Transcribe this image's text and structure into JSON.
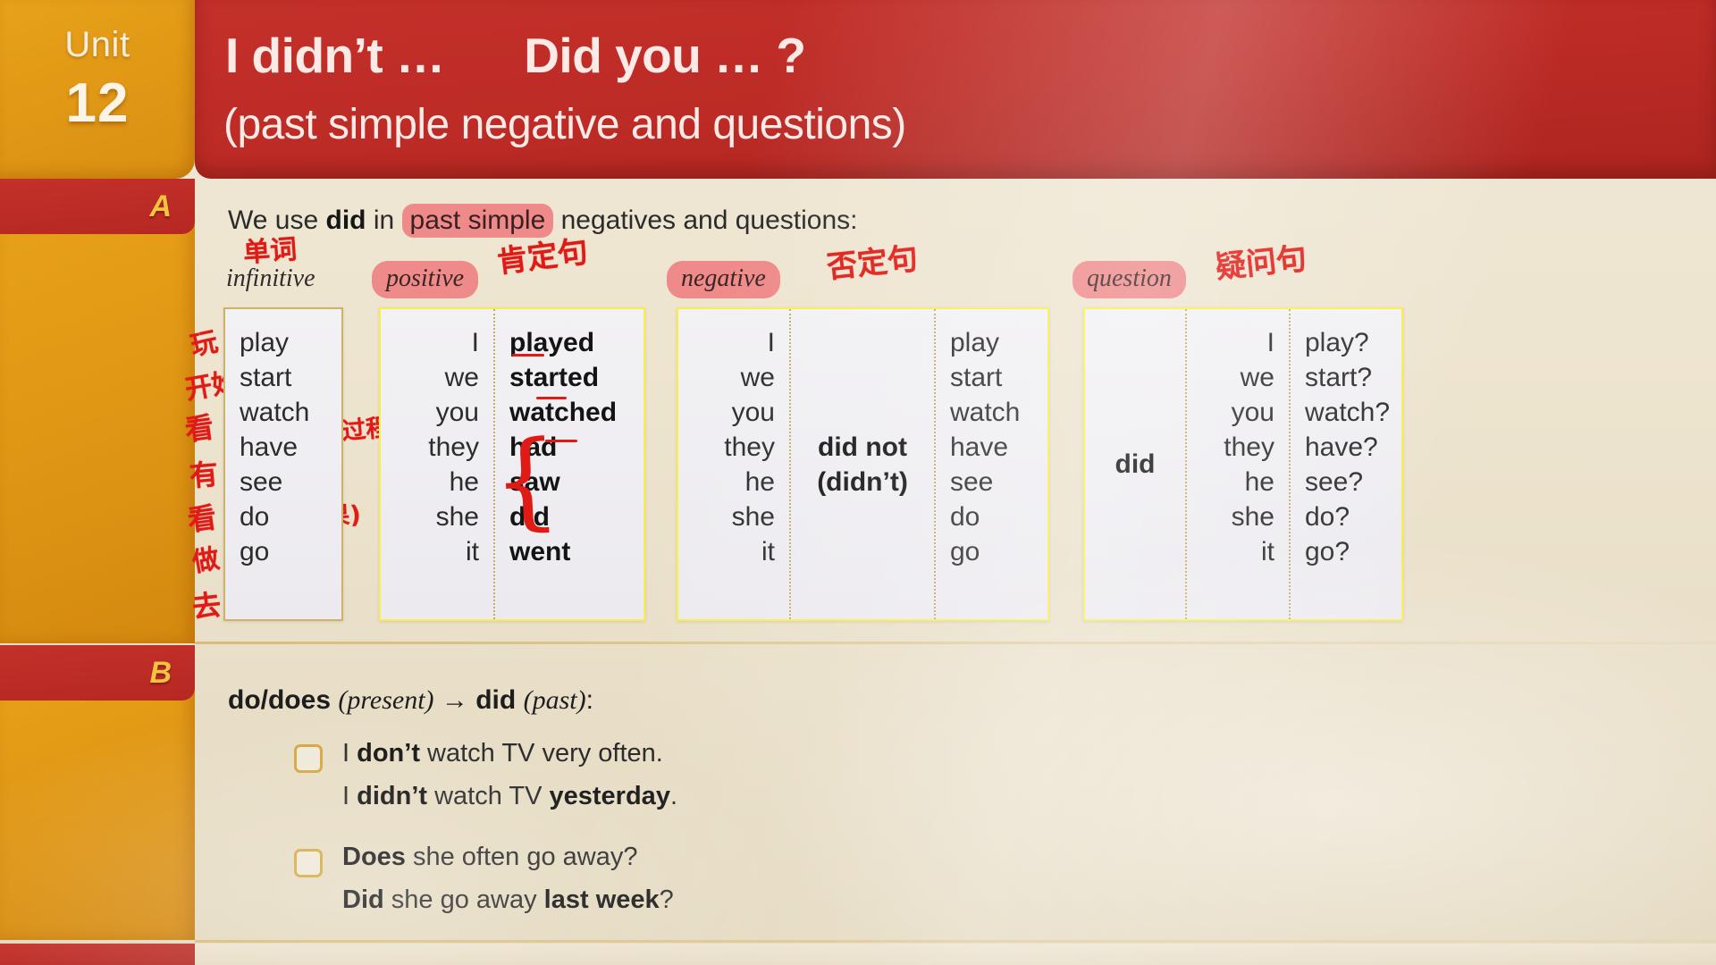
{
  "unit": {
    "label": "Unit",
    "number": "12"
  },
  "title": {
    "line1": "I didn’t …      Did you … ?",
    "line2": "(past simple negative and questions)"
  },
  "sections": {
    "a_letter": "A",
    "b_letter": "B"
  },
  "section_a": {
    "intro_pre": "We use ",
    "intro_bold": "did",
    "intro_mid": " in ",
    "intro_hl": "past simple",
    "intro_post": " negatives and questions:",
    "labels": {
      "infinitive": "infinitive",
      "positive": "positive",
      "negative": "negative",
      "question": "question"
    },
    "annotations": {
      "danci": "单词",
      "kendingju": "肯定句",
      "foudingju": "否定句",
      "yiwenju": "疑问句",
      "wan": "玩",
      "kaishi": "开始",
      "kan": "看",
      "you": "有",
      "kan2": "看",
      "zuo": "做",
      "qu": "去",
      "guocheng": "(过程)",
      "jieguo": "(结果)"
    },
    "infinitive_list": [
      "play",
      "start",
      "watch",
      "have",
      "see",
      "do",
      "go"
    ],
    "positive": {
      "subjects": [
        "I",
        "we",
        "you",
        "they",
        "he",
        "she",
        "it"
      ],
      "verbs": [
        "played",
        "started",
        "watched",
        "had",
        "saw",
        "did",
        "went"
      ]
    },
    "negative": {
      "subjects": [
        "I",
        "we",
        "you",
        "they",
        "he",
        "she",
        "it"
      ],
      "aux_line1": "did not",
      "aux_line2": "(didn’t)",
      "verbs": [
        "play",
        "start",
        "watch",
        "have",
        "see",
        "do",
        "go"
      ]
    },
    "question": {
      "aux": "did",
      "subjects": [
        "I",
        "we",
        "you",
        "they",
        "he",
        "she",
        "it"
      ],
      "verbs": [
        "play?",
        "start?",
        "watch?",
        "have?",
        "see?",
        "do?",
        "go?"
      ]
    }
  },
  "section_b": {
    "heading_bold1": "do/does",
    "heading_italic1": "(present)",
    "heading_arrow": "→",
    "heading_bold2": "did",
    "heading_italic2": "(past)",
    "heading_colon": ":",
    "examples": [
      {
        "line1": {
          "pre": "I ",
          "bold": "don’t",
          "post": " watch TV very often."
        },
        "line2": {
          "pre": "I ",
          "bold": "didn’t",
          "mid": " watch TV ",
          "bold2": "yesterday",
          "post": "."
        }
      },
      {
        "line1": {
          "bold": "Does",
          "post": " she often go away?"
        },
        "line2": {
          "bold": "Did",
          "mid": " she go away ",
          "bold2": "last week",
          "post": "?"
        }
      }
    ]
  },
  "colors": {
    "red_header": "#c4302a",
    "orange_tab": "#e9a21b",
    "paper": "#eee5d0",
    "highlight_pink": "#ef8a8a",
    "ink_red": "#e01b16",
    "box_yellow": "#f7ef49",
    "box_tan": "#cbb36a",
    "checkbox_gold": "#d4a63a"
  }
}
